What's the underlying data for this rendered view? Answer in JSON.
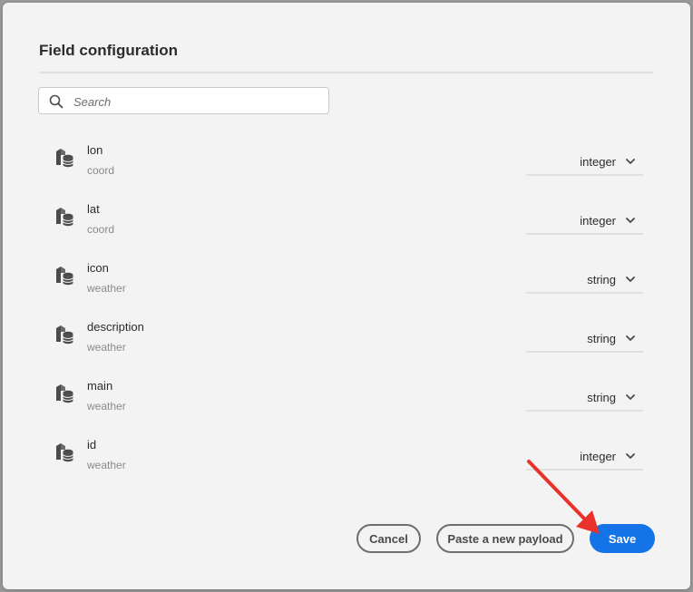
{
  "dialog": {
    "title": "Field configuration",
    "search": {
      "placeholder": "Search"
    },
    "fields": [
      {
        "name": "lon",
        "parent": "coord",
        "type": "integer"
      },
      {
        "name": "lat",
        "parent": "coord",
        "type": "integer"
      },
      {
        "name": "icon",
        "parent": "weather",
        "type": "string"
      },
      {
        "name": "description",
        "parent": "weather",
        "type": "string"
      },
      {
        "name": "main",
        "parent": "weather",
        "type": "string"
      },
      {
        "name": "id",
        "parent": "weather",
        "type": "integer"
      }
    ],
    "buttons": {
      "cancel": "Cancel",
      "paste": "Paste a new payload",
      "save": "Save"
    }
  },
  "icons": {
    "field": "field-type-icon",
    "search": "search-icon",
    "dropdown": "chevron-down-icon",
    "annotation": "red-arrow-icon"
  },
  "colors": {
    "accent": "#1473e6",
    "annotation": "#e8322a"
  }
}
